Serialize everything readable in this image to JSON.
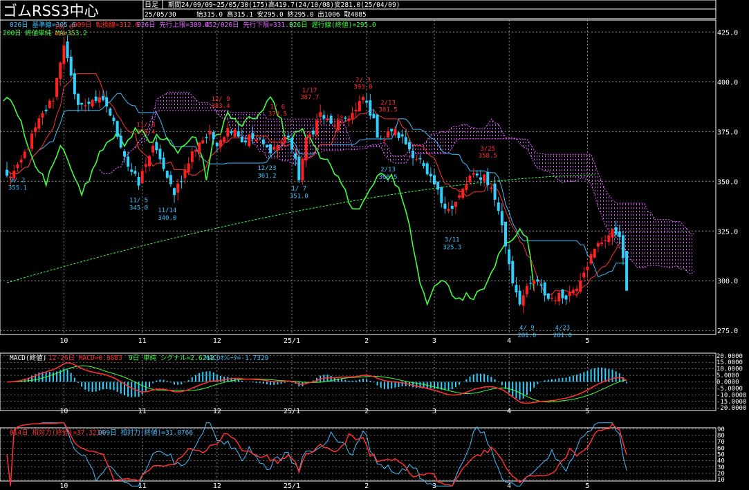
{
  "header": {
    "title": "ゴムRSS3中心",
    "timeframe": "日足",
    "period_line": "期間24/09/09~25/05/30(175)高419.7(24/10/08)安281.0(25/04/09)",
    "date": "25/05/30",
    "ohlc_line": "始315.0 高315.1 安295.0 終295.0 出1006 取4085"
  },
  "legend": {
    "row1": [
      {
        "text": "026日 基準線=305.6",
        "color": "#40c0ff"
      },
      {
        "text": "009日 転換線=312.6",
        "color": "#ff3030"
      },
      {
        "text": "026日 先行上限=309.4",
        "color": "#e060ff"
      },
      {
        "text": "052/026日 先行下限=331.9",
        "color": "#e060ff"
      },
      {
        "text": "026日 遅行線(終値)=295.0",
        "color": "#40ff40"
      }
    ],
    "row2": [
      {
        "text": "200日 終値単純 MA=353.2",
        "color": "#40ff40"
      }
    ]
  },
  "macd_legend": [
    {
      "text": "MACD(終値)",
      "color": "#ffffff"
    },
    {
      "text": "12-26日 MACD=0.8883",
      "color": "#ff3030"
    },
    {
      "text": "9日 単純 シグナル=2.6212",
      "color": "#40ff40"
    },
    {
      "text": "MACDｵｼﾚｰﾀ=-1.7329",
      "color": "#40c0ff"
    }
  ],
  "rsi_legend": [
    {
      "text": "014日 相対力(終値)=37.3214",
      "color": "#ff3030"
    },
    {
      "text": "009日 相対力(終値)=31.0766",
      "color": "#40c0ff"
    }
  ],
  "colors": {
    "up": "#ff2020",
    "down": "#30d0ff",
    "kijun": "#40c0ff",
    "tenkan": "#ff3030",
    "chikou": "#40ff40",
    "ma200": "#40ff40",
    "cloud": "#e060ff",
    "grid": "#c8c8c8",
    "axis_text": "#ffffff",
    "annot_high": "#ff3030",
    "annot_low": "#40c0ff"
  },
  "chart_data": [
    {
      "type": "candlestick",
      "y_ticks": [
        425.0,
        400.0,
        375.0,
        350.0,
        325.0,
        300.0,
        275.0
      ],
      "y_tick_labels": [
        "425.0",
        "400.0",
        "375.0",
        "350.0",
        "325.0",
        "300.0",
        "275.0"
      ],
      "ylim": [
        273,
        431
      ],
      "x_month_labels": [
        "10",
        "11",
        "12",
        "25/1",
        "2",
        "3",
        "4",
        "5"
      ],
      "x_month_positions": [
        16,
        38,
        59,
        80,
        101,
        120,
        141,
        163
      ],
      "n_bars": 175,
      "keypoints": [
        [
          0,
          352
        ],
        [
          3,
          356
        ],
        [
          6,
          368
        ],
        [
          9,
          380
        ],
        [
          13,
          392
        ],
        [
          15,
          411
        ],
        [
          16,
          419.7
        ],
        [
          19,
          392
        ],
        [
          22,
          387
        ],
        [
          24,
          392
        ],
        [
          28,
          388
        ],
        [
          31,
          374
        ],
        [
          34,
          358
        ],
        [
          37,
          348
        ],
        [
          39,
          360
        ],
        [
          41,
          366
        ],
        [
          43,
          362
        ],
        [
          45,
          350
        ],
        [
          47,
          345
        ],
        [
          50,
          355
        ],
        [
          52,
          364
        ],
        [
          54,
          370
        ],
        [
          57,
          373
        ],
        [
          59,
          370
        ],
        [
          62,
          376
        ],
        [
          64,
          377
        ],
        [
          66,
          370
        ],
        [
          68,
          372
        ],
        [
          71,
          370
        ],
        [
          73,
          366
        ],
        [
          75,
          367
        ],
        [
          77,
          370
        ],
        [
          79,
          373
        ],
        [
          82,
          352
        ],
        [
          84,
          370
        ],
        [
          86,
          376
        ],
        [
          88,
          384
        ],
        [
          91,
          378
        ],
        [
          94,
          380
        ],
        [
          96,
          383
        ],
        [
          98,
          385
        ],
        [
          100,
          392
        ],
        [
          102,
          385
        ],
        [
          104,
          374
        ],
        [
          106,
          371
        ],
        [
          108,
          376
        ],
        [
          110,
          373
        ],
        [
          112,
          369
        ],
        [
          114,
          364
        ],
        [
          116,
          360
        ],
        [
          118,
          352
        ],
        [
          120,
          348
        ],
        [
          122,
          340
        ],
        [
          125,
          336
        ],
        [
          127,
          342
        ],
        [
          130,
          352
        ],
        [
          132,
          352
        ],
        [
          134,
          353
        ],
        [
          136,
          346
        ],
        [
          138,
          336
        ],
        [
          140,
          318
        ],
        [
          142,
          300
        ],
        [
          144,
          290
        ],
        [
          146,
          295
        ],
        [
          148,
          300
        ],
        [
          150,
          296
        ],
        [
          152,
          291
        ],
        [
          154,
          292
        ],
        [
          156,
          292
        ],
        [
          158,
          294
        ],
        [
          160,
          298
        ],
        [
          162,
          306
        ],
        [
          164,
          312
        ],
        [
          166,
          318
        ],
        [
          168,
          322
        ],
        [
          170,
          324
        ],
        [
          172,
          324
        ],
        [
          174,
          295
        ]
      ],
      "annotations": [
        {
          "date": "10/ 8",
          "price": "419.7",
          "bar": 16,
          "kind": "high"
        },
        {
          "date": "11/ 8",
          "price": "370.4",
          "bar": 39,
          "kind": "high"
        },
        {
          "date": "12/ 9",
          "price": "383.4",
          "bar": 60,
          "kind": "high"
        },
        {
          "date": "1/ 6",
          "price": "379.5",
          "bar": 76,
          "kind": "high"
        },
        {
          "date": "1/17",
          "price": "387.7",
          "bar": 85,
          "kind": "high"
        },
        {
          "date": "2/ 3",
          "price": "393.0",
          "bar": 100,
          "kind": "high"
        },
        {
          "date": "2/13",
          "price": "381.5",
          "bar": 107,
          "kind": "high"
        },
        {
          "date": "3/25",
          "price": "358.5",
          "bar": 135,
          "kind": "high"
        },
        {
          "date": "9/ 2",
          "price": "355.1",
          "bar": 3,
          "kind": "low"
        },
        {
          "date": "11/ 5",
          "price": "345.0",
          "bar": 37,
          "kind": "low"
        },
        {
          "date": "11/14",
          "price": "340.0",
          "bar": 45,
          "kind": "low"
        },
        {
          "date": "12/23",
          "price": "361.2",
          "bar": 73,
          "kind": "low"
        },
        {
          "date": "1/ 7",
          "price": "351.0",
          "bar": 82,
          "kind": "low"
        },
        {
          "date": "2/13",
          "price": "360.5",
          "bar": 107,
          "kind": "low"
        },
        {
          "date": "3/11",
          "price": "325.3",
          "bar": 125,
          "kind": "low"
        },
        {
          "date": "4/ 9",
          "price": "281.0",
          "bar": 146,
          "kind": "low"
        },
        {
          "date": "4/23",
          "price": "281.0",
          "bar": 156,
          "kind": "low"
        }
      ],
      "ma200": {
        "start": 299,
        "end": 353.2
      }
    },
    {
      "type": "macd",
      "y_ticks": [
        20,
        15,
        10,
        5,
        0,
        -5,
        -10,
        -15,
        -20
      ],
      "y_tick_labels": [
        "20.0000",
        "15.0000",
        "10.0000",
        "5.0000",
        "0.0000",
        "-5.0000",
        "-10.0000",
        "-15.0000",
        "-20.0000"
      ],
      "ylim": [
        -22,
        22
      ]
    },
    {
      "type": "rsi",
      "y_ticks": [
        90,
        80,
        70,
        60,
        50,
        40,
        30,
        20,
        10
      ],
      "y_tick_labels": [
        "90",
        "80",
        "70",
        "60",
        "50",
        "40",
        "30",
        "20",
        "10"
      ],
      "ylim": [
        8,
        92
      ]
    }
  ]
}
